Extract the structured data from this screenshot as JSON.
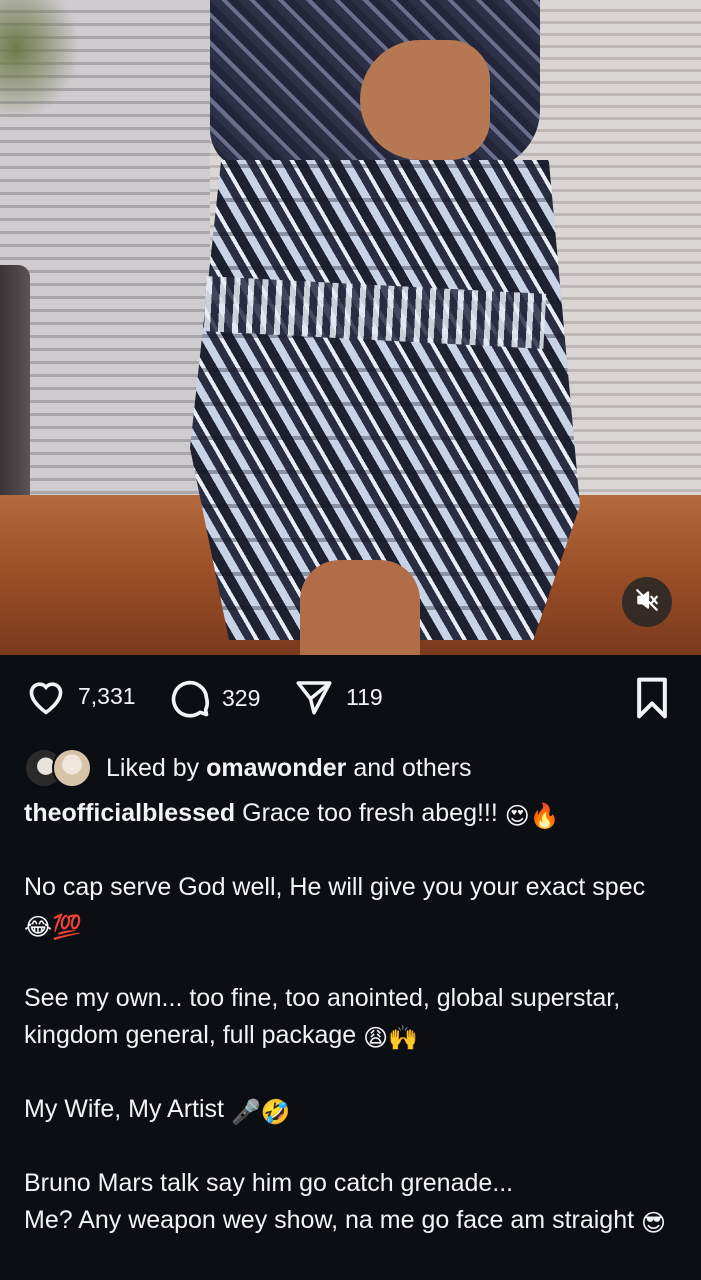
{
  "post": {
    "likes_count": "7,331",
    "comments_count": "329",
    "shares_count": "119"
  },
  "liked_by": {
    "prefix": "Liked by",
    "user": "omawonder",
    "suffix": "and others"
  },
  "caption": {
    "username": "theofficialblessed",
    "line1_text": "Grace too fresh abeg!!!",
    "line1_emoji": "😍🔥",
    "line2_text": "No cap serve God well, He will give you your exact spec",
    "line2_emoji": "😂💯",
    "line3_text": "See my own... too fine, too anointed, global superstar, kingdom general, full package",
    "line3_emoji": "😩🙌",
    "line4_text": "My Wife, My Artist",
    "line4_emoji": "🎤🤣",
    "line5_a": "Bruno Mars talk say him go catch grenade...",
    "line5_b": "Me? Any weapon wey show, na me go face am straight",
    "line5_emoji": "😎"
  },
  "icons": {
    "like": "heart-icon",
    "comment": "comment-icon",
    "share": "share-icon",
    "save": "bookmark-icon",
    "mute": "speaker-muted-icon"
  },
  "colors": {
    "background": "#0b0e12",
    "text": "#f2f3f5"
  }
}
